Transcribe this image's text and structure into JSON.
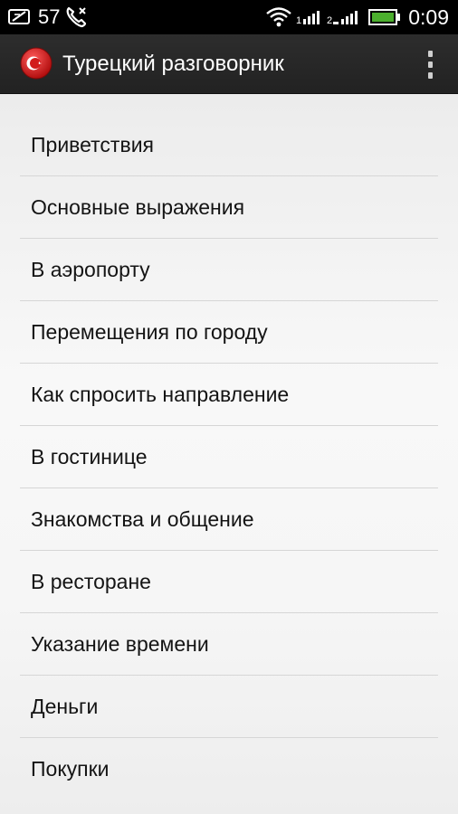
{
  "status_bar": {
    "notification_count": "57",
    "time": "0:09",
    "icons": [
      "evernote-note-icon",
      "missed-call-icon",
      "wifi-icon",
      "signal-icon-1",
      "signal-icon-2",
      "battery-icon"
    ],
    "battery_color": "#4caf2e"
  },
  "action_bar": {
    "title": "Турецкий разговорник",
    "icon": "turkey-flag-icon",
    "flag_color": "#d21b1b"
  },
  "topics": [
    "Приветствия",
    "Основные выражения",
    "В аэропорту",
    "Перемещения по городу",
    "Как спросить направление",
    "В гостинице",
    "Знакомства и общение",
    "В ресторане",
    "Указание времени",
    "Деньги",
    "Покупки"
  ]
}
